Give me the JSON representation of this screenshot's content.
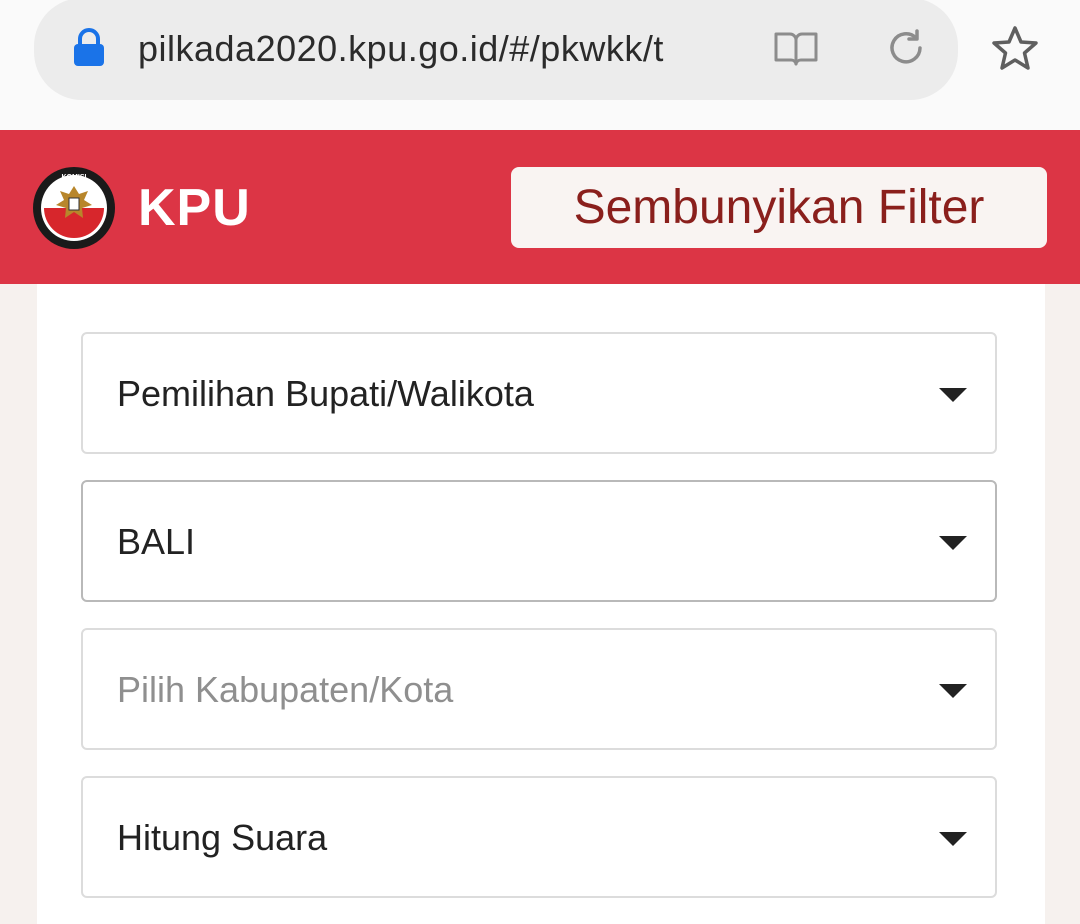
{
  "browser": {
    "url": "pilkada2020.kpu.go.id/#/pkwkk/t"
  },
  "header": {
    "brand": "KPU",
    "filter_button_label": "Sembunyikan Filter",
    "logo_text_top": "KOMISI",
    "logo_text_bottom": "PEMILIHAN UMUM"
  },
  "filters": {
    "election_type": "Pemilihan Bupati/Walikota",
    "province": "BALI",
    "regency_placeholder": "Pilih Kabupaten/Kota",
    "view_type": "Hitung Suara"
  },
  "colors": {
    "brand_red": "#dc3545",
    "button_text": "#8a1f1c"
  }
}
